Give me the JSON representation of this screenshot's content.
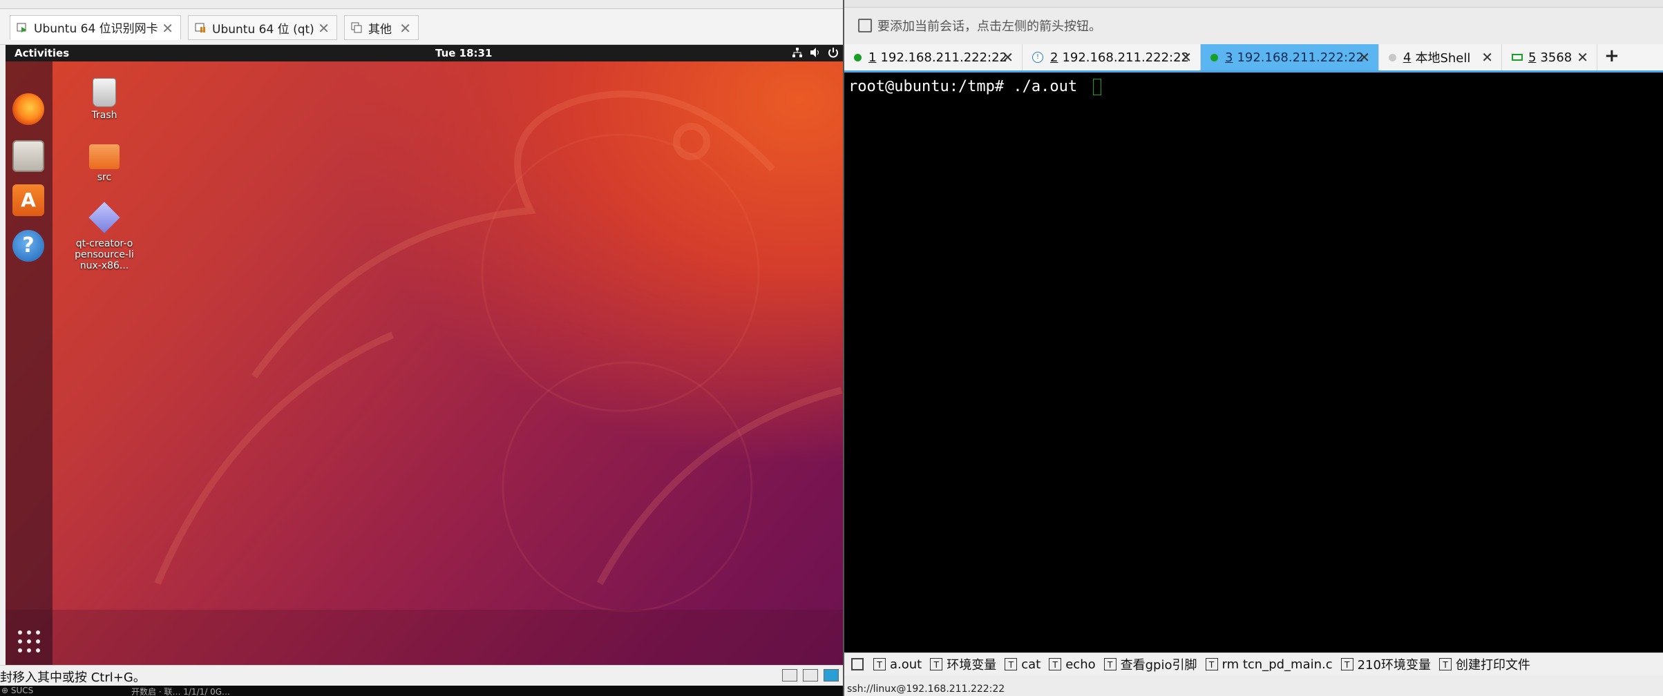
{
  "vm": {
    "tabs": [
      {
        "label": "Ubuntu 64 位识别网卡",
        "active": true
      },
      {
        "label": "Ubuntu 64 位 (qt)",
        "active": false
      },
      {
        "label": "其他",
        "active": false
      }
    ],
    "close_glyph": "✕",
    "ubuntu": {
      "activities": "Activities",
      "clock": "Tue 18:31",
      "tray_icons": [
        "network-icon",
        "volume-icon",
        "power-icon"
      ],
      "desktop_icons": [
        {
          "label": "Trash",
          "icon": "trash-icon"
        },
        {
          "label": "src",
          "icon": "folder-icon"
        },
        {
          "label": "qt-creator-opensource-linux-x86...",
          "icon": "qt-installer-icon"
        }
      ],
      "dock": [
        "firefox-icon",
        "files-icon",
        "software-center-icon",
        "help-icon",
        "show-apps-icon"
      ],
      "software_glyph": "A",
      "help_glyph": "?"
    },
    "status_hint": "封移入其中或按 Ctrl+G。",
    "bottom_fragments": [
      "⊕ SUCS",
      "开数启 · 联… 1/1/1/ 0G…"
    ]
  },
  "terminal": {
    "session_hint": "要添加当前会话，点击左侧的箭头按钮。",
    "tabs": [
      {
        "index": "1",
        "label": "192.168.211.222:22",
        "status": "green",
        "active": false
      },
      {
        "index": "2",
        "label": "192.168.211.222:22",
        "status": "warning",
        "active": false
      },
      {
        "index": "3",
        "label": "192.168.211.222:22",
        "status": "green",
        "active": true
      },
      {
        "index": "4",
        "label": "本地Shell",
        "status": "gray",
        "active": false
      },
      {
        "index": "5",
        "label": "3568",
        "status": "serial",
        "active": false
      }
    ],
    "add_tab_glyph": "+",
    "prompt_line": "root@ubuntu:/tmp# ./a.out ",
    "macros": [
      "a.out",
      "环境变量",
      "cat",
      "echo",
      "查看gpio引脚",
      "rm tcn_pd_main.c",
      "210环境变量",
      "创建打印文件"
    ],
    "macro_glyph": "T",
    "status_text": "ssh://linux@192.168.211.222:22"
  },
  "colors": {
    "active_tab": "#5bb5f0",
    "status_green": "#18a026",
    "cursor_green": "#17a02a"
  }
}
